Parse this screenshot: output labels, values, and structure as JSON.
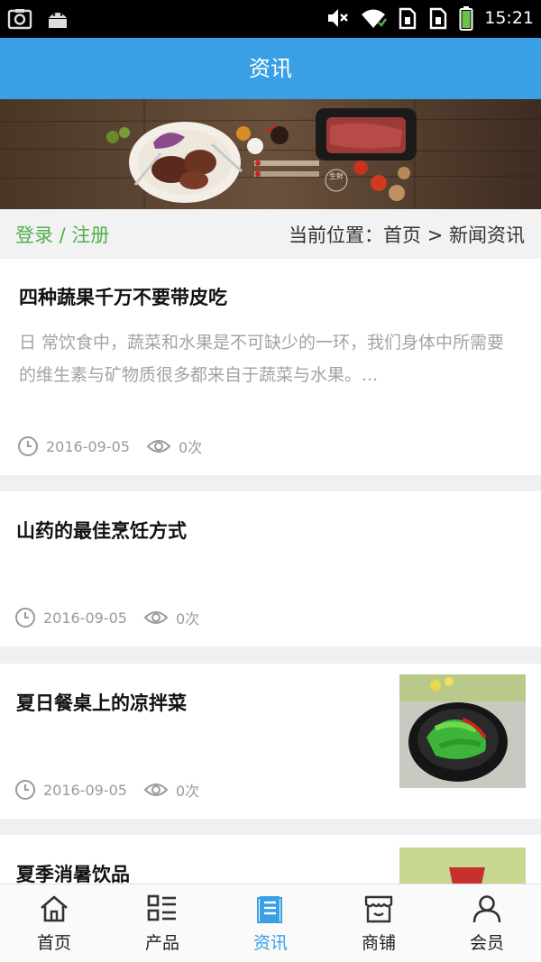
{
  "status_bar": {
    "time": "15:21"
  },
  "header": {
    "title": "资讯"
  },
  "banner": {
    "tag": "生鲜"
  },
  "breadcrumb": {
    "login": "登录 / 注册",
    "location": "当前位置：首页 > 新闻资讯"
  },
  "articles": [
    {
      "title": "四种蔬果千万不要带皮吃",
      "summary": "日 常饮食中，蔬菜和水果是不可缺少的一环，我们身体中所需要的维生素与矿物质很多都来自于蔬菜与水果。...",
      "date": "2016-09-05",
      "views": "0次"
    },
    {
      "title": "山药的最佳烹饪方式",
      "summary": "",
      "date": "2016-09-05",
      "views": "0次"
    },
    {
      "title": "夏日餐桌上的凉拌菜",
      "summary": "",
      "date": "2016-09-05",
      "views": "0次"
    },
    {
      "title": "夏季消暑饮品",
      "summary": "",
      "date": "",
      "views": ""
    }
  ],
  "tabs": [
    {
      "label": "首页",
      "icon": "home-icon"
    },
    {
      "label": "产品",
      "icon": "grid-list-icon"
    },
    {
      "label": "资讯",
      "icon": "document-icon"
    },
    {
      "label": "商铺",
      "icon": "shop-icon"
    },
    {
      "label": "会员",
      "icon": "user-icon"
    }
  ],
  "colors": {
    "header_bg": "#3aa0e6",
    "login_green": "#4db04a",
    "active_tab": "#3aa0e6"
  }
}
